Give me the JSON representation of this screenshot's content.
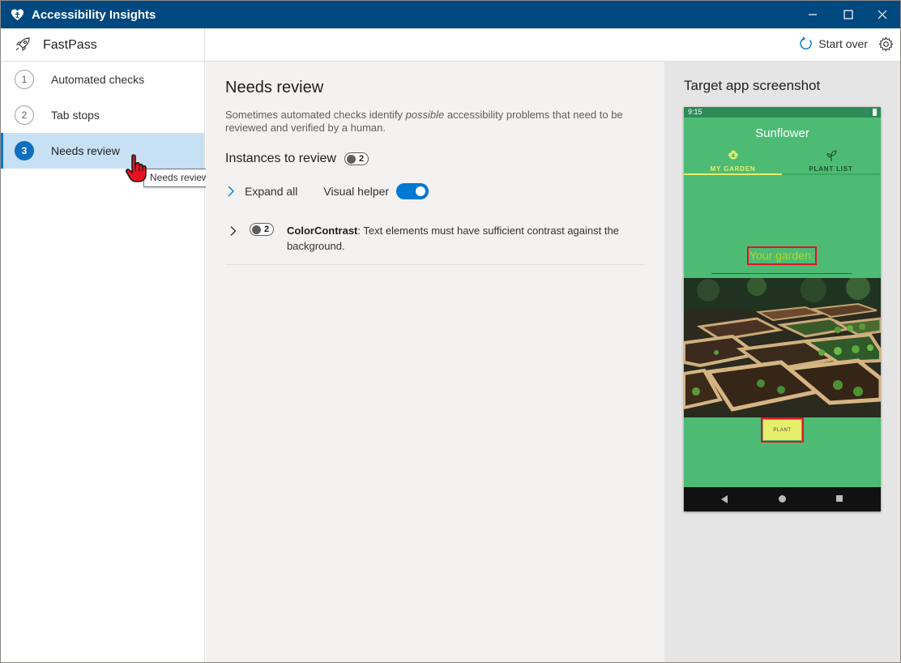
{
  "window": {
    "title": "Accessibility Insights",
    "minimize_icon": "minimize-icon",
    "maximize_icon": "maximize-icon",
    "close_icon": "close-icon"
  },
  "header": {
    "mode_icon": "rocket-icon",
    "mode_name": "FastPass",
    "start_over": "Start over",
    "settings_icon": "gear-icon"
  },
  "nav": {
    "items": [
      {
        "number": "1",
        "label": "Automated checks",
        "selected": false
      },
      {
        "number": "2",
        "label": "Tab stops",
        "selected": false
      },
      {
        "number": "3",
        "label": "Needs review",
        "selected": true
      }
    ],
    "tooltip": "Needs review"
  },
  "main": {
    "title": "Needs review",
    "description_before": "Sometimes automated checks identify ",
    "description_emphasis": "possible",
    "description_after": " accessibility problems that need to be reviewed and verified by a human.",
    "instances_label": "Instances to review",
    "instances_count": "2",
    "expand_all": "Expand all",
    "visual_helper": "Visual helper",
    "visual_helper_on": true,
    "rules": [
      {
        "count": "2",
        "rule_id": "ColorContrast",
        "description": ": Text elements must have sufficient contrast against the background."
      }
    ]
  },
  "screenshot_panel": {
    "title": "Target app screenshot",
    "phone": {
      "status_time": "9:15",
      "app_name": "Sunflower",
      "tabs": [
        "MY GARDEN",
        "PLANT LIST"
      ],
      "garden_text": "Your garden:",
      "plant_button": "PLANT"
    }
  },
  "colors": {
    "titlebar": "#004880",
    "accent": "#0078d4",
    "selected_nav": "#c7e0f4",
    "highlight_box": "#e81123",
    "phone_green": "#4dbb74"
  }
}
